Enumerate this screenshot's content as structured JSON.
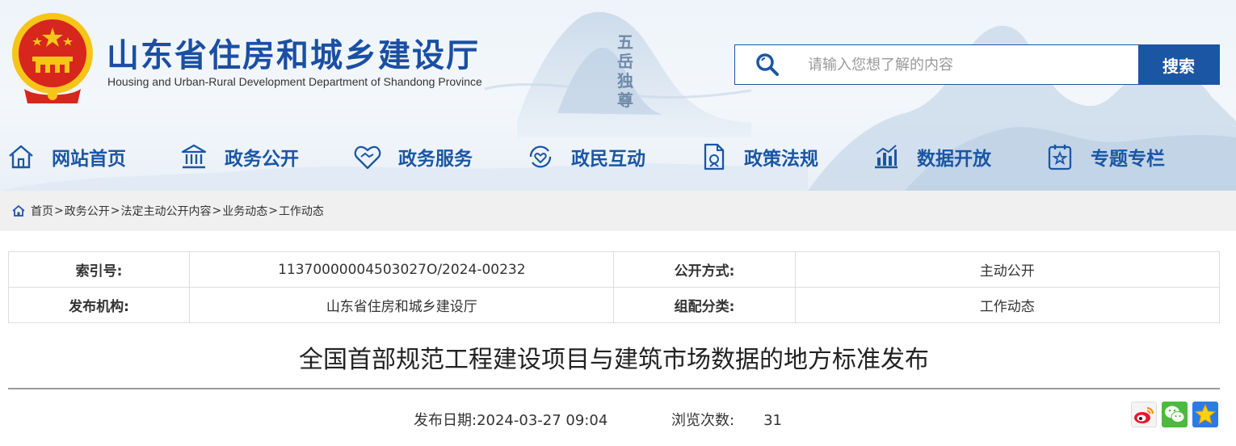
{
  "header": {
    "title_cn": "山东省住房和城乡建设厅",
    "title_en": "Housing and Urban-Rural Development Department of Shandong Province",
    "mountain_text": "五岳独尊",
    "search": {
      "placeholder": "请输入您想了解的内容",
      "button_label": "搜索"
    }
  },
  "nav": {
    "items": [
      {
        "label": "网站首页",
        "icon": "home-icon"
      },
      {
        "label": "政务公开",
        "icon": "government-building-icon"
      },
      {
        "label": "政务服务",
        "icon": "handshake-heart-icon"
      },
      {
        "label": "政民互动",
        "icon": "interaction-icon"
      },
      {
        "label": "政策法规",
        "icon": "policy-document-icon"
      },
      {
        "label": "数据开放",
        "icon": "bar-chart-icon"
      },
      {
        "label": "专题专栏",
        "icon": "special-topic-icon"
      }
    ]
  },
  "breadcrumb": {
    "items": [
      "首页",
      "政务公开",
      "法定主动公开内容",
      "业务动态",
      "工作动态"
    ],
    "separator": ">"
  },
  "info": {
    "index_label": "索引号:",
    "index_value": "11370000004503027O/2024-00232",
    "open_mode_label": "公开方式:",
    "open_mode_value": "主动公开",
    "publisher_label": "发布机构:",
    "publisher_value": "山东省住房和城乡建设厅",
    "category_label": "组配分类:",
    "category_value": "工作动态"
  },
  "article": {
    "title": "全国首部规范工程建设项目与建筑市场数据的地方标准发布",
    "publish_date_label": "发布日期:",
    "publish_date": "2024-03-27 09:04",
    "views_label": "浏览次数:",
    "views": "31"
  },
  "share": [
    "weibo-icon",
    "wechat-icon",
    "favorite-star-icon"
  ],
  "colors": {
    "brand_blue": "#1b56a5",
    "breadcrumb_bg": "#f0f0f0",
    "emblem_red": "#d7261d",
    "emblem_gold": "#f5c518"
  }
}
